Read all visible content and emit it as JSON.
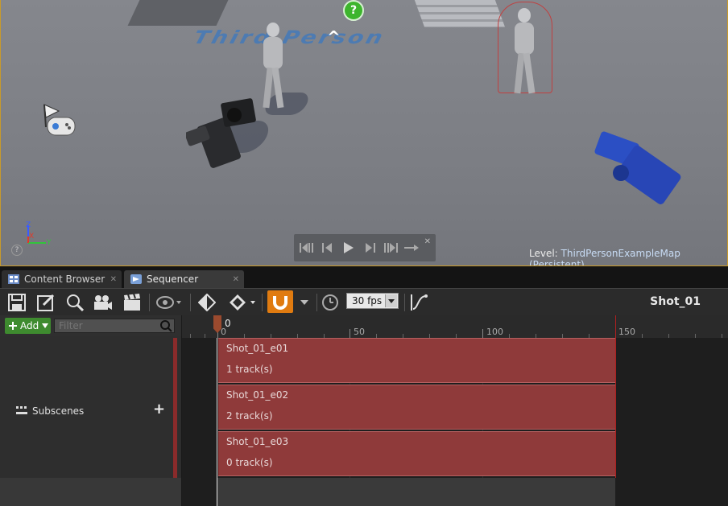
{
  "viewport": {
    "floor_text": "Third Person",
    "level_label": "Level:",
    "level_name": "ThirdPersonExampleMap (Persistent)",
    "axis": {
      "z": "Z",
      "x": "X",
      "y": "Y"
    }
  },
  "tabs": [
    {
      "label": "Content Browser",
      "icon": "content-browser-icon"
    },
    {
      "label": "Sequencer",
      "icon": "sequencer-icon"
    }
  ],
  "toolbar": {
    "fps": "30 fps",
    "shot_name": "Shot_01"
  },
  "left_panel": {
    "add_label": "Add",
    "filter_placeholder": "Filter",
    "subscenes_label": "Subscenes"
  },
  "timeline": {
    "current_frame": "0",
    "ticks": [
      "0",
      "50",
      "100",
      "150"
    ]
  },
  "rows": [
    {
      "name": "Shot_01_e01",
      "tracks": "1 track(s)"
    },
    {
      "name": "Shot_01_e02",
      "tracks": "2 track(s)"
    },
    {
      "name": "Shot_01_e03",
      "tracks": "0 track(s)"
    }
  ],
  "colors": {
    "accent_orange": "#e07b10",
    "add_green": "#3e8b2f",
    "section_red": "#8f3a3a",
    "viewport_border": "#c89a2a"
  }
}
